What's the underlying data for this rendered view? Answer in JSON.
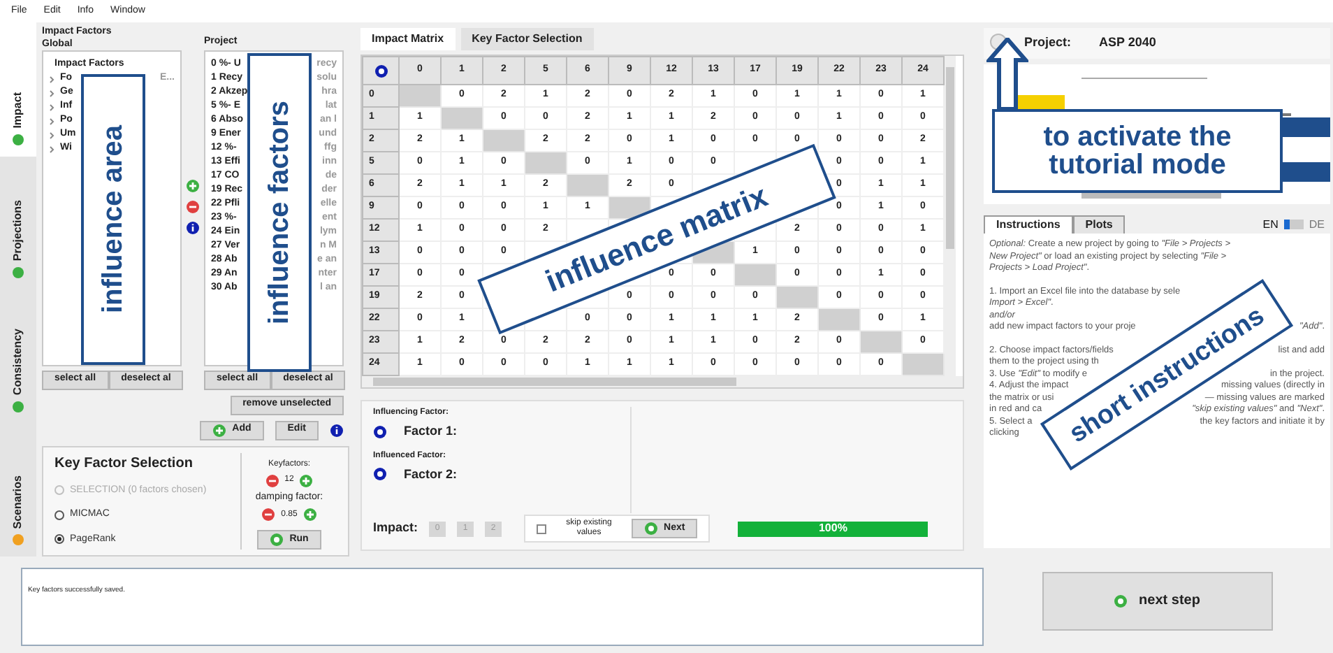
{
  "menu": [
    "File",
    "Edit",
    "Info",
    "Window"
  ],
  "side_tabs": [
    {
      "label": "Impact",
      "selected": true,
      "color": "#3cb043"
    },
    {
      "label": "Projections",
      "selected": false,
      "color": "#3cb043"
    },
    {
      "label": "Consistency",
      "selected": false,
      "color": "#3cb043"
    },
    {
      "label": "Scenarios",
      "selected": false,
      "color": "#f0a020"
    }
  ],
  "global_panel": {
    "title": "Impact Factors Global",
    "list_header": "Impact Factors",
    "items": [
      {
        "label": "Fo",
        "tail": "E..."
      },
      {
        "label": "Ge"
      },
      {
        "label": "Inf"
      },
      {
        "label": "Po"
      },
      {
        "label": "Um"
      },
      {
        "label": "Wi"
      }
    ],
    "buttons": [
      "select all",
      "deselect al"
    ]
  },
  "project_panel": {
    "title": "Project",
    "items": [
      {
        "label": "0 %- U",
        "tail": "recy"
      },
      {
        "label": "1 Recy",
        "tail": "solu"
      },
      {
        "label": "2 Akzep",
        "tail": "hra"
      },
      {
        "label": "5 %- E",
        "tail": "lat"
      },
      {
        "label": "6 Abso",
        "tail": "an l"
      },
      {
        "label": "9 Ener",
        "tail": "und"
      },
      {
        "label": "12 %-",
        "tail": "ffg"
      },
      {
        "label": "13 Effi",
        "tail": "inn"
      },
      {
        "label": "17 CO",
        "tail": "de"
      },
      {
        "label": "19 Rec",
        "tail": "der"
      },
      {
        "label": "22 Pfli",
        "tail": "elle"
      },
      {
        "label": "23 %-",
        "tail": "ent"
      },
      {
        "label": "24 Ein",
        "tail": "lym"
      },
      {
        "label": "27 Ver",
        "tail": "n M"
      },
      {
        "label": "28 Ab",
        "tail": "e an"
      },
      {
        "label": "29 An",
        "tail": "nter"
      },
      {
        "label": "30 Ab",
        "tail": "l an"
      }
    ],
    "buttons": [
      "select all",
      "deselect al"
    ],
    "remove": "remove unselected",
    "add": "Add",
    "edit": "Edit"
  },
  "key_factor_selection": {
    "title": "Key Factor Selection",
    "options": [
      {
        "label": "SELECTION (0 factors chosen)",
        "selected": false,
        "disabled": true
      },
      {
        "label": "MICMAC",
        "selected": false,
        "disabled": false
      },
      {
        "label": "PageRank",
        "selected": true,
        "disabled": false
      }
    ],
    "keyfactors_label": "Keyfactors:",
    "keyfactors": "12",
    "damping_label": "damping factor:",
    "damping": "0.85",
    "run": "Run"
  },
  "matrix_tabs": [
    {
      "label": "Impact Matrix",
      "selected": true
    },
    {
      "label": "Key Factor Selection",
      "selected": false
    }
  ],
  "matrix": {
    "columns": [
      "0",
      "1",
      "2",
      "5",
      "6",
      "9",
      "12",
      "13",
      "17",
      "19",
      "22",
      "23",
      "24"
    ],
    "rows": [
      {
        "label": "0",
        "cells": [
          null,
          "0",
          "2",
          "1",
          "2",
          "0",
          "2",
          "1",
          "0",
          "1",
          "1",
          "0",
          "1"
        ]
      },
      {
        "label": "1",
        "cells": [
          "1",
          null,
          "0",
          "0",
          "2",
          "1",
          "1",
          "2",
          "0",
          "0",
          "1",
          "0",
          "0"
        ]
      },
      {
        "label": "2",
        "cells": [
          "2",
          "1",
          null,
          "2",
          "2",
          "0",
          "1",
          "0",
          "0",
          "0",
          "0",
          "0",
          "2"
        ]
      },
      {
        "label": "5",
        "cells": [
          "0",
          "1",
          "0",
          null,
          "0",
          "1",
          "0",
          "0",
          null,
          null,
          "0",
          "0",
          "1"
        ]
      },
      {
        "label": "6",
        "cells": [
          "2",
          "1",
          "1",
          "2",
          null,
          "2",
          "0",
          null,
          null,
          null,
          "0",
          "1",
          "1"
        ]
      },
      {
        "label": "9",
        "cells": [
          "0",
          "0",
          "0",
          "1",
          "1",
          null,
          null,
          null,
          null,
          null,
          "0",
          "1",
          "0"
        ]
      },
      {
        "label": "12",
        "cells": [
          "1",
          "0",
          "0",
          "2",
          null,
          null,
          null,
          null,
          null,
          "2",
          "0",
          "0",
          "1"
        ]
      },
      {
        "label": "13",
        "cells": [
          "0",
          "0",
          "0",
          null,
          null,
          null,
          null,
          null,
          "1",
          "0",
          "0",
          "0",
          "0"
        ]
      },
      {
        "label": "17",
        "cells": [
          "0",
          "0",
          null,
          null,
          null,
          null,
          "0",
          "0",
          null,
          "0",
          "0",
          "1",
          "0"
        ]
      },
      {
        "label": "19",
        "cells": [
          "2",
          "0",
          null,
          null,
          null,
          "0",
          "0",
          "0",
          "0",
          null,
          "0",
          "0",
          "0"
        ]
      },
      {
        "label": "22",
        "cells": [
          "0",
          "1",
          null,
          null,
          "0",
          "0",
          "1",
          "1",
          "1",
          "2",
          null,
          "0",
          "1"
        ]
      },
      {
        "label": "23",
        "cells": [
          "1",
          "2",
          "0",
          "2",
          "2",
          "0",
          "1",
          "1",
          "0",
          "2",
          "0",
          null,
          "0"
        ]
      },
      {
        "label": "24",
        "cells": [
          "1",
          "0",
          "0",
          "0",
          "1",
          "1",
          "1",
          "0",
          "0",
          "0",
          "0",
          "0",
          null
        ]
      }
    ]
  },
  "factor_panel": {
    "influencing_label": "Influencing Factor:",
    "factor1": "Factor 1:",
    "influenced_label": "Influenced Factor:",
    "factor2": "Factor 2:",
    "impact_label": "Impact:",
    "impact_buttons": [
      {
        "label": "0",
        "disabled": true
      },
      {
        "label": "1",
        "disabled": true
      },
      {
        "label": "2",
        "disabled": true
      }
    ],
    "skip": {
      "label": "skip existing values",
      "checked": false
    },
    "next": "Next",
    "progress": {
      "level": 1,
      "reading": "100%"
    }
  },
  "log": "Key factors successfully saved.",
  "project": {
    "label": "Project:",
    "name": "ASP 2040"
  },
  "info_tabs": [
    {
      "label": "Instructions",
      "selected": true
    },
    {
      "label": "Plots",
      "selected": false
    }
  ],
  "languages": [
    {
      "label": "EN",
      "selected": true
    },
    {
      "label": "DE",
      "selected": false
    }
  ],
  "instructions": [
    {
      "left": "*Optional:* Create a new project by going to *\"File > Projects >*"
    },
    {
      "left": "*New Project\"* or load an existing project by selecting *\"File >*"
    },
    {
      "left": "*Projects > Load Project\"*."
    },
    {
      "kind": "gap"
    },
    {
      "left": "1. Import an Excel file into the database by sele"
    },
    {
      "left": "*Import > Excel\"*."
    },
    {
      "left": "*and/or*"
    },
    {
      "left": "add new impact factors to your proje",
      "right": "*\"Add\"*."
    },
    {
      "kind": "gap"
    },
    {
      "left": "2. Choose impact factors/fields",
      "right": "list and add"
    },
    {
      "left": "them to the project using th"
    },
    {
      "left": "3. Use *\"Edit\"* to modify e",
      "right": "in the project."
    },
    {
      "left": "4. Adjust the impact",
      "right": "missing values (directly in"
    },
    {
      "left": "the matrix or usi",
      "right": "— missing values are marked"
    },
    {
      "left": "in red and ca",
      "right": "*\"skip existing values\"* and *\"Next\"*."
    },
    {
      "left": "5. Select a",
      "right": "the key factors and initiate it by"
    },
    {
      "left": "clicking"
    }
  ],
  "next_step": "next step",
  "annotations": [
    {
      "kind": "area",
      "text": "influence area"
    },
    {
      "kind": "factors",
      "text": "influence factors"
    },
    {
      "kind": "matrix",
      "text": "influence matrix"
    },
    {
      "kind": "tutorial",
      "text": "to activate the tutorial mode"
    },
    {
      "kind": "instructions",
      "text": "short instructions"
    }
  ]
}
